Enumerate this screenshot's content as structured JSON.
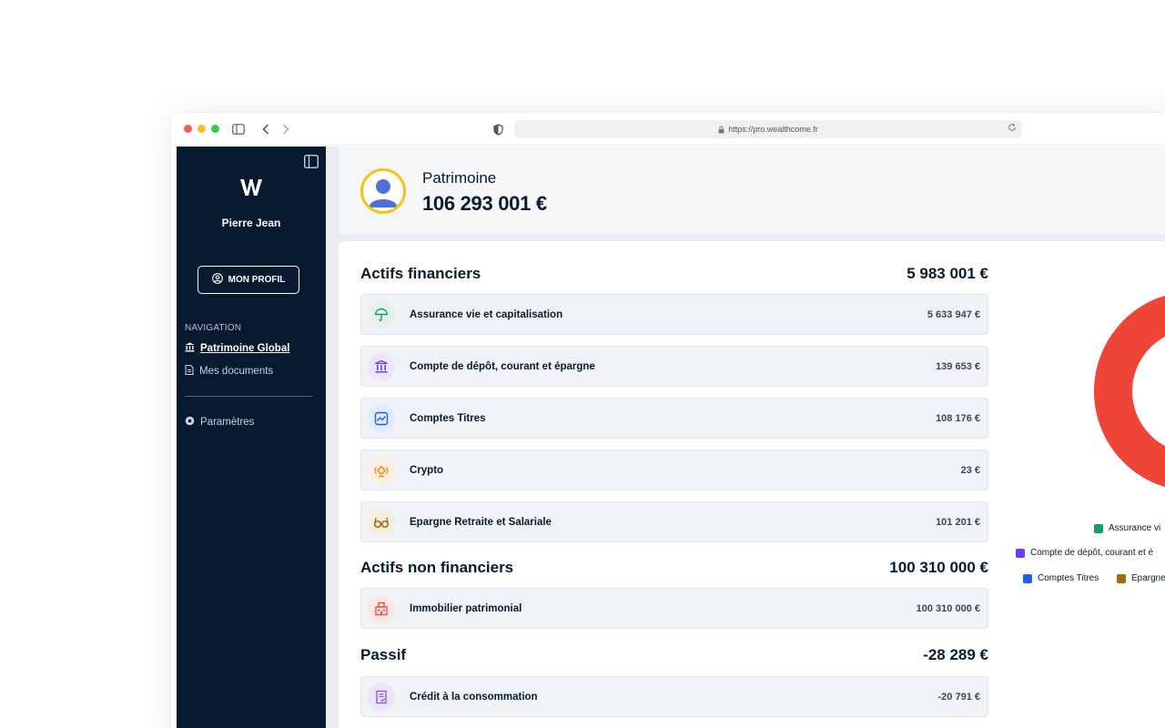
{
  "browser": {
    "url": "https://pro.wealthcome.fr",
    "dots": [
      "#f25f58",
      "#fbbe2e",
      "#38c94a"
    ]
  },
  "sidebar": {
    "logo_text": "W",
    "user_name": "Pierre Jean",
    "profile_button": "MON PROFIL",
    "nav_heading": "NAVIGATION",
    "items": [
      {
        "label": "Patrimoine Global",
        "icon": "bank-icon",
        "active": true
      },
      {
        "label": "Mes documents",
        "icon": "document-icon",
        "active": false
      }
    ],
    "settings_label": "Paramètres"
  },
  "header": {
    "title": "Patrimoine",
    "total": "106 293 001 €"
  },
  "sections": {
    "financial": {
      "title": "Actifs financiers",
      "total": "5 983 001 €",
      "rows": [
        {
          "label": "Assurance vie et capitalisation",
          "value": "5 633 947 €",
          "icon": "umbrella-icon",
          "color": "#1a9b6a"
        },
        {
          "label": "Compte de dépôt, courant et épargne",
          "value": "139 653 €",
          "icon": "bank-icon",
          "color": "#6a3df0"
        },
        {
          "label": "Comptes Titres",
          "value": "108 176 €",
          "icon": "chart-icon",
          "color": "#1f5fe0"
        },
        {
          "label": "Crypto",
          "value": "23 €",
          "icon": "crypto-icon",
          "color": "#f08a1c"
        },
        {
          "label": "Epargne Retraite et Salariale",
          "value": "101 201 €",
          "icon": "glasses-icon",
          "color": "#a06a12"
        }
      ]
    },
    "non_financial": {
      "title": "Actifs non financiers",
      "total": "100 310 000 €",
      "rows": [
        {
          "label": "Immobilier patrimonial",
          "value": "100 310 000 €",
          "icon": "building-icon",
          "color": "#e94b3c"
        }
      ]
    },
    "liabilities": {
      "title": "Passif",
      "total": "-28 289 €",
      "rows": [
        {
          "label": "Crédit à la consommation",
          "value": "-20 791 €",
          "icon": "credit-icon",
          "color": "#8a4de8"
        }
      ]
    }
  },
  "chart_data": {
    "type": "pie",
    "categories": [
      "Assurance vi",
      "Compte de dépôt, courant et é",
      "Comptes Titres",
      "Epargne"
    ],
    "colors": {
      "main_ring": "#ef4438",
      "assurance": "#1a9b6a",
      "compte": "#6a3df0",
      "titres": "#1f5fe0",
      "epargne": "#a06a12"
    }
  }
}
